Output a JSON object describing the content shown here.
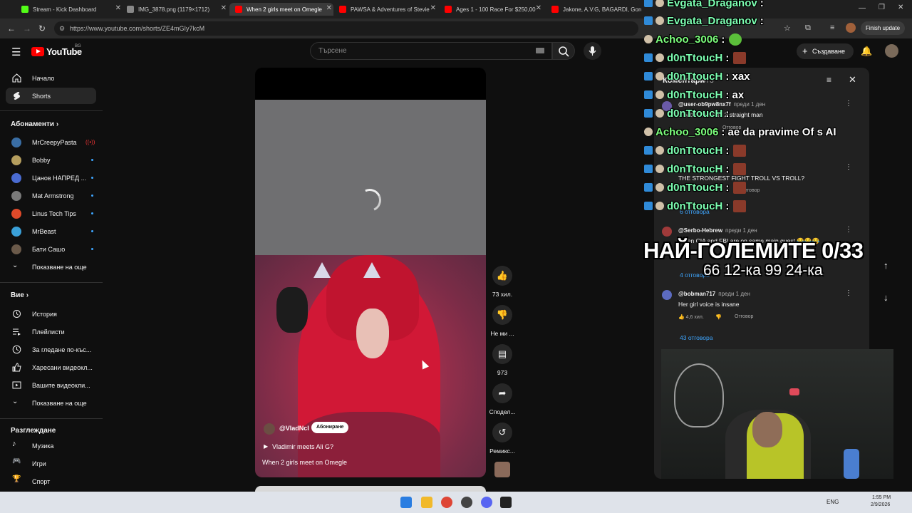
{
  "browser": {
    "tabs": [
      {
        "label": "Stream - Kick Dashboard",
        "color": "#53fc18"
      },
      {
        "label": "IMG_3878.png (1179×1712)",
        "color": "#888888"
      },
      {
        "label": "When 2 girls meet on Omegle",
        "color": "#ff0000"
      },
      {
        "label": "PAWSA & Adventures of Stevie",
        "color": "#ff0000"
      },
      {
        "label": "Ages 1 - 100 Race For $250,00",
        "color": "#ff0000"
      },
      {
        "label": "Jakone, A.V.G, BAGARDI, Goro",
        "color": "#ff0000"
      }
    ],
    "url": "https://www.youtube.com/shorts/ZE4mGIy7kcM",
    "finish_update": "Finish update"
  },
  "youtube": {
    "logo_text": "YouTube",
    "region": "BG",
    "search_placeholder": "Търсене",
    "create_label": "Създаване",
    "sidebar": {
      "top": [
        {
          "label": "Начало",
          "icon": "home-icon"
        },
        {
          "label": "Shorts",
          "icon": "shorts-icon"
        }
      ],
      "subscriptions_header": "Абонаменти",
      "subscriptions": [
        {
          "label": "MrCreepyPasta",
          "color": "#3a6ea5",
          "live": true
        },
        {
          "label": "Bobby",
          "color": "#b59e5e"
        },
        {
          "label": "Цанов НАПРЕД ...",
          "color": "#4a6bd1"
        },
        {
          "label": "Mat Armstrong",
          "color": "#7a7a7a"
        },
        {
          "label": "Linus Tech Tips",
          "color": "#e04a2a"
        },
        {
          "label": "MrBeast",
          "color": "#3aa0d8"
        },
        {
          "label": "Бати Сашо",
          "color": "#6b5a4a"
        }
      ],
      "show_more_1": "Показване на още",
      "you_header": "Вие",
      "you_items": [
        {
          "label": "История",
          "icon": "history-icon"
        },
        {
          "label": "Плейлисти",
          "icon": "playlist-icon"
        },
        {
          "label": "За гледане по-къс...",
          "icon": "watch-later-icon"
        },
        {
          "label": "Харесани видеокл...",
          "icon": "liked-icon"
        },
        {
          "label": "Вашите видеокли...",
          "icon": "your-videos-icon"
        }
      ],
      "show_more_2": "Показване на още",
      "explore_header": "Разглеждане",
      "explore_items": [
        {
          "label": "Музика",
          "icon": "music-icon"
        },
        {
          "label": "Игри",
          "icon": "games-icon"
        },
        {
          "label": "Спорт",
          "icon": "sport-icon"
        }
      ]
    },
    "short": {
      "channel": "@VladNcl",
      "subscribe": "Абониране",
      "sound": "Vladimir meets Ali G?",
      "title": "When 2 girls meet on Omegle",
      "actions": [
        {
          "icon": "like-icon",
          "label": "73 хил."
        },
        {
          "icon": "dislike-icon",
          "label": "Не ми ..."
        },
        {
          "icon": "comment-icon",
          "label": "973"
        },
        {
          "icon": "share-icon",
          "label": "Сподел..."
        },
        {
          "icon": "remix-icon",
          "label": "Ремикс..."
        }
      ]
    },
    "comments": {
      "title": "Коментари",
      "count": "973",
      "items": [
        {
          "author": "@user-ob9pw8nx7f",
          "time": "преди 1 ден",
          "text": "a battle between 2 straight man",
          "reply": "Отговор"
        },
        {
          "author": "",
          "time": "",
          "text": "THE STRONGEST FIGHT TROLL VS TROLL?",
          "reply": "Отговор",
          "replies": "6 отговора"
        },
        {
          "author": "@Serbo-Hebrew",
          "time": "преди 1 ден",
          "text": "When CIA and FBI are on same main quest 😂😂😂",
          "replies": "4 отговора"
        },
        {
          "author": "@bobman717",
          "time": "преди 1 ден",
          "text": "Her girl voice is insane",
          "likes": "4,6 хил.",
          "reply": "Отговор",
          "replies": "43 отговора"
        }
      ]
    }
  },
  "stream_overlay": {
    "chat": [
      {
        "user": "Evgata_Draganov",
        "msg": ""
      },
      {
        "user": "Evgata_Draganov",
        "msg": ""
      },
      {
        "user": "Achoo_3006",
        "msg": ""
      },
      {
        "user": "d0nTtoucH",
        "msg": ""
      },
      {
        "user": "d0nTtoucH",
        "msg": "хах"
      },
      {
        "user": "d0nTtoucH",
        "msg": "ах"
      },
      {
        "user": "d0nTtoucH",
        "msg": ""
      },
      {
        "user": "Achoo_3006",
        "msg": "ае da pravime Of s AI"
      },
      {
        "user": "d0nTtoucH",
        "msg": ""
      },
      {
        "user": "d0nTtoucH",
        "msg": ""
      },
      {
        "user": "d0nTtoucH",
        "msg": ""
      },
      {
        "user": "d0nTtoucH",
        "msg": ""
      }
    ],
    "headline": "НАЙ-ГОЛЕМИТЕ 0/33",
    "subline": "66 12-ка 99 24-ка"
  },
  "taskbar": {
    "lang": "ENG",
    "time": "1:55 PM",
    "date": "2/9/2026"
  }
}
